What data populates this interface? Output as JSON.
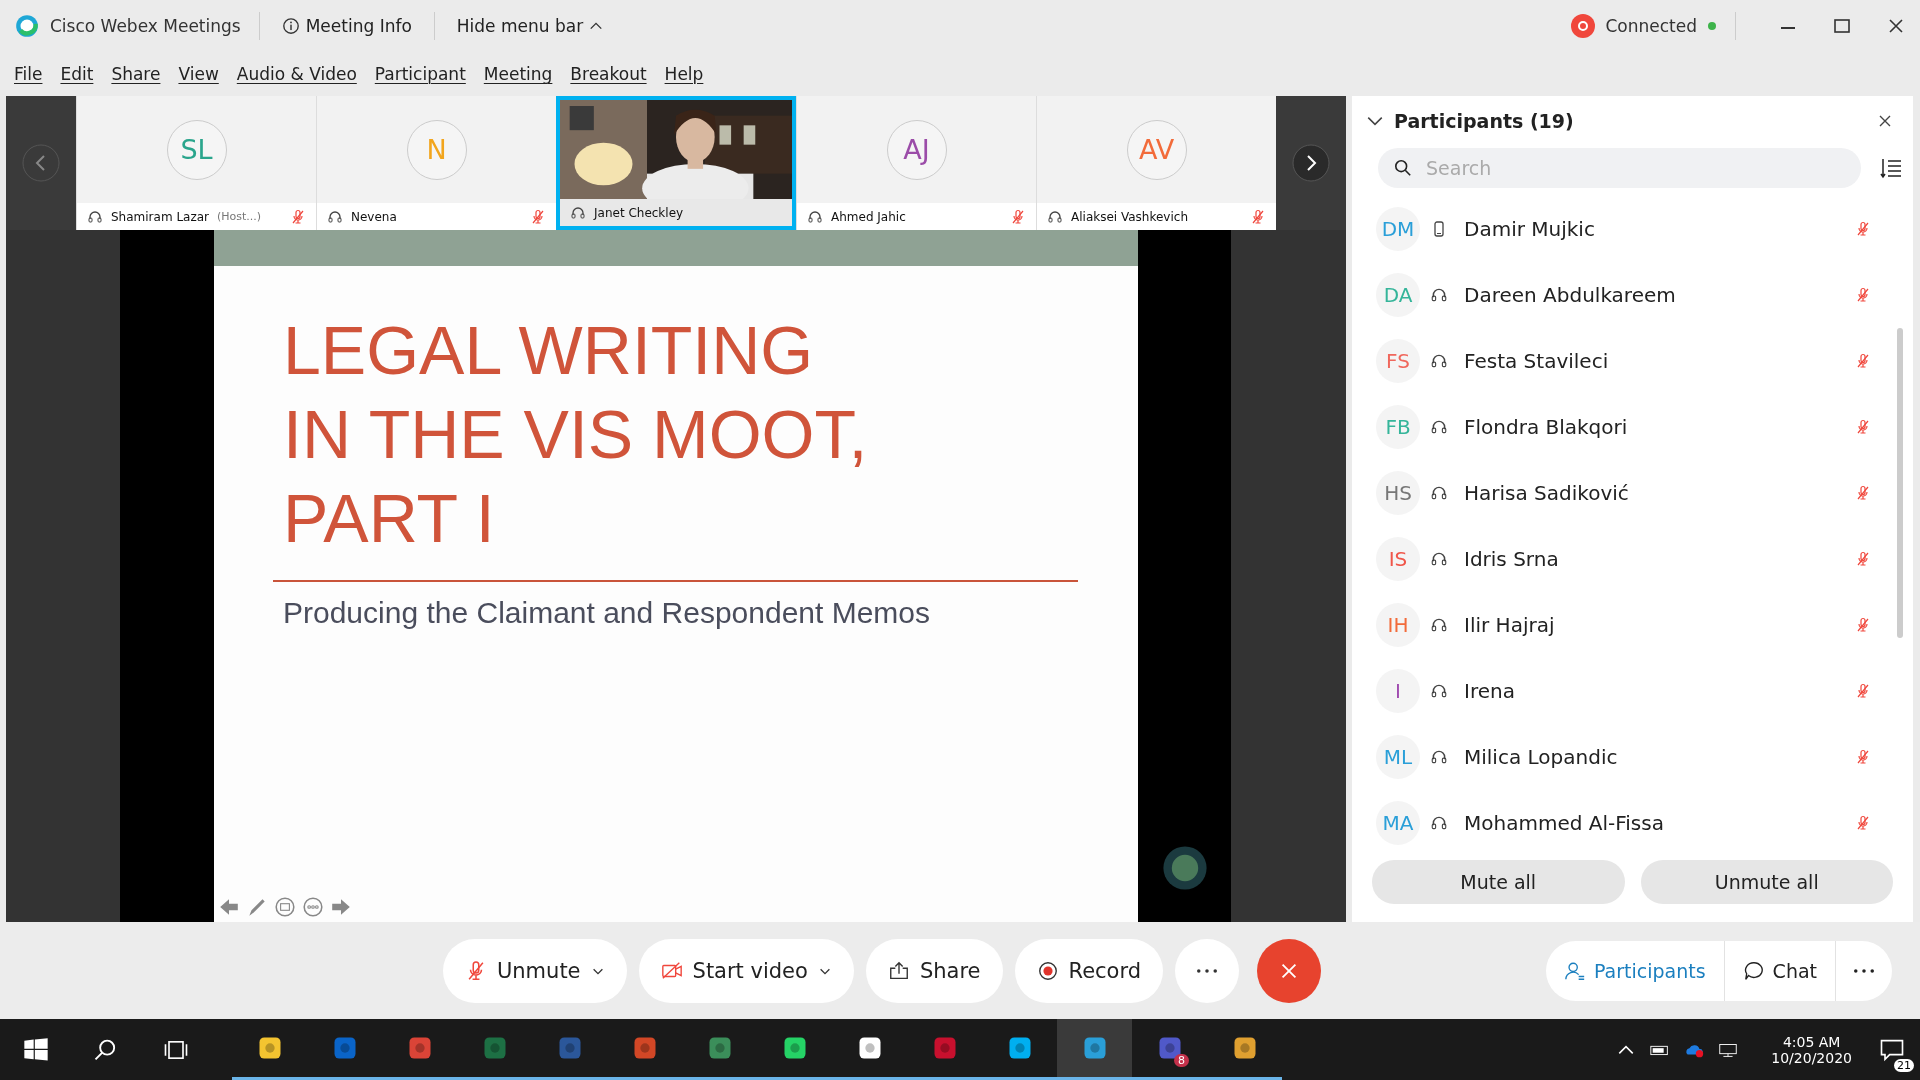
{
  "window": {
    "app_title": "Cisco Webex Meetings",
    "meeting_info": "Meeting Info",
    "hide_menu": "Hide menu bar",
    "status": "Connected"
  },
  "menu": [
    "File",
    "Edit",
    "Share",
    "View",
    "Audio & Video",
    "Participant",
    "Meeting",
    "Breakout",
    "Help"
  ],
  "video_strip": [
    {
      "kind": "avatar",
      "initials": "SL",
      "color": "#2aa58c",
      "name": "Shamiram Lazar",
      "note": "(Host...)",
      "muted": true,
      "selected": false
    },
    {
      "kind": "avatar",
      "initials": "N",
      "color": "#f2a51d",
      "name": "Nevena",
      "muted": true,
      "selected": false
    },
    {
      "kind": "video",
      "name": "Janet Checkley",
      "muted": false,
      "selected": true
    },
    {
      "kind": "avatar",
      "initials": "AJ",
      "color": "#9b4ca8",
      "name": "Ahmed Jahic",
      "muted": true,
      "selected": false
    },
    {
      "kind": "avatar",
      "initials": "AV",
      "color": "#f26b3a",
      "name": "Aliaksei Vashkevich",
      "muted": true,
      "selected": false
    }
  ],
  "slide": {
    "title_lines": [
      "LEGAL WRITING",
      "IN THE VIS MOOT,",
      "PART I"
    ],
    "subtitle": "Producing the Claimant and Respondent Memos"
  },
  "participants_panel": {
    "title": "Participants (19)",
    "search": {
      "placeholder": "Search"
    },
    "participants": [
      {
        "initials": "DM",
        "color": "#2a9fd8",
        "name": "Damir Mujkic",
        "kind": "phone",
        "muted": true
      },
      {
        "initials": "DA",
        "color": "#35b59a",
        "name": "Dareen Abdulkareem",
        "kind": "headset",
        "muted": true
      },
      {
        "initials": "FS",
        "color": "#f0675c",
        "name": "Festa Stavileci",
        "kind": "headset",
        "muted": true
      },
      {
        "initials": "FB",
        "color": "#35b59a",
        "name": "Flondra Blakqori",
        "kind": "headset",
        "muted": true
      },
      {
        "initials": "HS",
        "color": "#777777",
        "name": "Harisa Sadiković",
        "kind": "headset",
        "muted": true
      },
      {
        "initials": "IS",
        "color": "#f0564a",
        "name": "Idris Srna",
        "kind": "headset",
        "muted": true
      },
      {
        "initials": "IH",
        "color": "#f26b3a",
        "name": "Ilir Hajraj",
        "kind": "headset",
        "muted": true
      },
      {
        "initials": "I",
        "color": "#a04cb0",
        "name": "Irena",
        "kind": "headset",
        "muted": true
      },
      {
        "initials": "ML",
        "color": "#2a9fd8",
        "name": "Milica Lopandic",
        "kind": "headset",
        "muted": true
      },
      {
        "initials": "MA",
        "color": "#2a9fd8",
        "name": "Mohammed Al-Fissa",
        "kind": "headset",
        "muted": true
      }
    ],
    "buttons": [
      "Mute all",
      "Unmute all"
    ]
  },
  "toolbar": {
    "controls": [
      {
        "kind": "unmute",
        "label": "Unmute"
      },
      {
        "kind": "video",
        "label": "Start video"
      },
      {
        "kind": "share",
        "label": "Share"
      },
      {
        "kind": "record",
        "label": "Record"
      },
      {
        "kind": "more"
      },
      {
        "kind": "leave"
      }
    ],
    "panels": [
      {
        "kind": "participants",
        "label": "Participants",
        "selected": true
      },
      {
        "kind": "chat",
        "label": "Chat",
        "selected": false
      },
      {
        "kind": "more",
        "selected": false
      }
    ]
  },
  "taskbar": {
    "time": "4:05 AM",
    "date": "10/20/2020",
    "notifications": "21",
    "teams_badge": "8"
  }
}
